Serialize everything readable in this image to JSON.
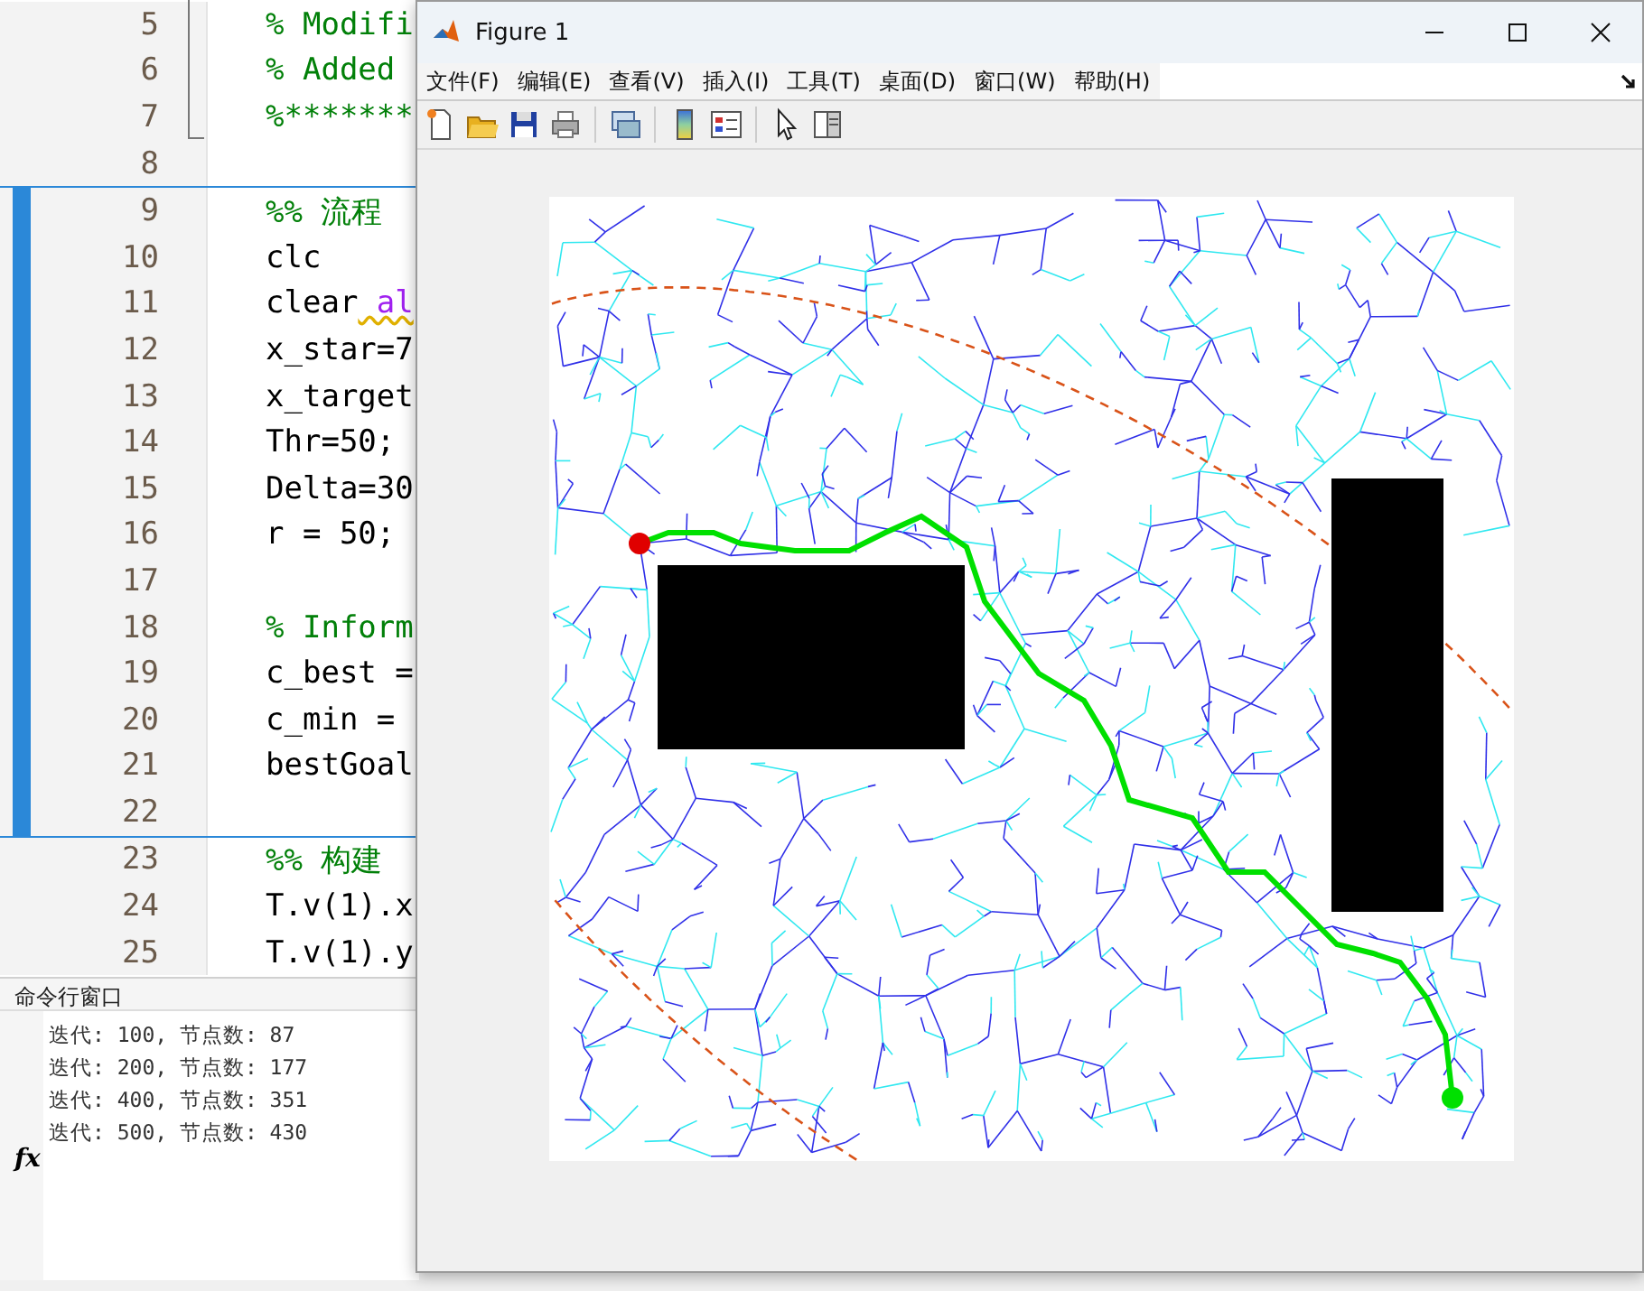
{
  "editor": {
    "lines": [
      {
        "number": "5",
        "in_section": false,
        "parts": [
          {
            "text": "% Modifi",
            "kind": "comment"
          }
        ]
      },
      {
        "number": "6",
        "in_section": false,
        "parts": [
          {
            "text": "% Added",
            "kind": "comment"
          }
        ]
      },
      {
        "number": "7",
        "in_section": false,
        "parts": [
          {
            "text": "%*******",
            "kind": "comment"
          }
        ]
      },
      {
        "number": "8",
        "in_section": false
      },
      {
        "number": "9",
        "in_section": true,
        "parts": [
          {
            "text": "%% 流程",
            "kind": "section"
          }
        ]
      },
      {
        "number": "10",
        "in_section": true,
        "parts": [
          {
            "text": "clc",
            "kind": "code"
          }
        ]
      },
      {
        "number": "11",
        "in_section": true,
        "parts": [
          {
            "text": "clear",
            "kind": "code"
          },
          {
            "text": "al",
            "kind": "keyword"
          }
        ]
      },
      {
        "number": "12",
        "in_section": true,
        "parts": [
          {
            "text": "x_star=7",
            "kind": "code"
          }
        ]
      },
      {
        "number": "13",
        "in_section": true,
        "parts": [
          {
            "text": "x_target",
            "kind": "code"
          }
        ]
      },
      {
        "number": "14",
        "in_section": true,
        "parts": [
          {
            "text": "Thr=50;",
            "kind": "code"
          }
        ]
      },
      {
        "number": "15",
        "in_section": true,
        "parts": [
          {
            "text": "Delta=30",
            "kind": "code"
          }
        ]
      },
      {
        "number": "16",
        "in_section": true,
        "parts": [
          {
            "text": "r = 50;",
            "kind": "code"
          }
        ]
      },
      {
        "number": "17",
        "in_section": true
      },
      {
        "number": "18",
        "in_section": true,
        "parts": [
          {
            "text": "% Inform",
            "kind": "comment"
          }
        ]
      },
      {
        "number": "19",
        "in_section": true,
        "parts": [
          {
            "text": "c_best =",
            "kind": "code"
          }
        ]
      },
      {
        "number": "20",
        "in_section": true,
        "parts": [
          {
            "text": "c_min =",
            "kind": "code"
          }
        ]
      },
      {
        "number": "21",
        "in_section": true,
        "parts": [
          {
            "text": "bestGoal",
            "kind": "code"
          }
        ]
      },
      {
        "number": "22",
        "in_section": true
      },
      {
        "number": "23",
        "in_section": false,
        "parts": [
          {
            "text": "%% 构建",
            "kind": "section"
          }
        ]
      },
      {
        "number": "24",
        "in_section": false,
        "parts": [
          {
            "text": "T.v(1).x",
            "kind": "code"
          }
        ]
      },
      {
        "number": "25",
        "in_section": false,
        "parts": [
          {
            "text": "T.v(1).y",
            "kind": "code"
          }
        ]
      }
    ]
  },
  "command_window": {
    "title": "命令行窗口",
    "lines": [
      "迭代: 100, 节点数: 87",
      "迭代: 200, 节点数: 177",
      "迭代: 400, 节点数: 351",
      "迭代: 500, 节点数: 430"
    ],
    "prompt": "fx"
  },
  "figure": {
    "title": "Figure 1",
    "menu": [
      "文件(F)",
      "编辑(E)",
      "查看(V)",
      "插入(I)",
      "工具(T)",
      "桌面(D)",
      "窗口(W)",
      "帮助(H)"
    ]
  }
}
